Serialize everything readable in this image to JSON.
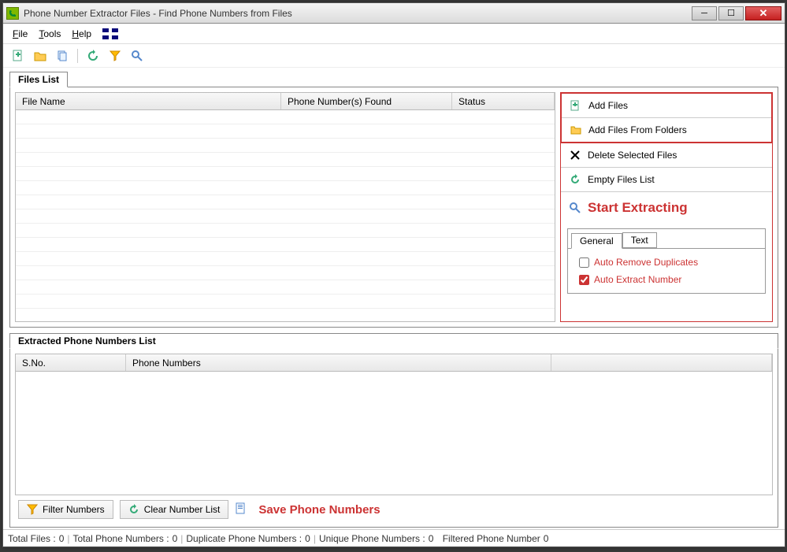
{
  "window": {
    "title": "Phone Number Extractor Files - Find Phone Numbers from Files"
  },
  "menu": {
    "file": "File",
    "tools": "Tools",
    "help": "Help"
  },
  "tabs": {
    "files_list": "Files List",
    "extracted_list": "Extracted Phone Numbers List"
  },
  "files_grid": {
    "cols": {
      "file_name": "File Name",
      "phone_found": "Phone Number(s) Found",
      "status": "Status"
    }
  },
  "actions": {
    "add_files": "Add Files",
    "add_folders": "Add Files From Folders",
    "delete_selected": "Delete Selected Files",
    "empty_list": "Empty Files List",
    "start": "Start Extracting"
  },
  "options": {
    "tab_general": "General",
    "tab_text": "Text",
    "auto_remove_dup": "Auto Remove Duplicates",
    "auto_extract": "Auto Extract Number"
  },
  "extracted_grid": {
    "cols": {
      "sno": "S.No.",
      "phone": "Phone Numbers"
    }
  },
  "bottom": {
    "filter": "Filter Numbers",
    "clear": "Clear Number List",
    "save": "Save Phone Numbers"
  },
  "status": {
    "total_files_lbl": "Total Files :",
    "total_files_val": "0",
    "total_phone_lbl": "Total Phone Numbers :",
    "total_phone_val": "0",
    "dup_lbl": "Duplicate Phone Numbers :",
    "dup_val": "0",
    "unique_lbl": "Unique Phone Numbers :",
    "unique_val": "0",
    "filtered_lbl": "Filtered Phone Number",
    "filtered_val": "0"
  }
}
